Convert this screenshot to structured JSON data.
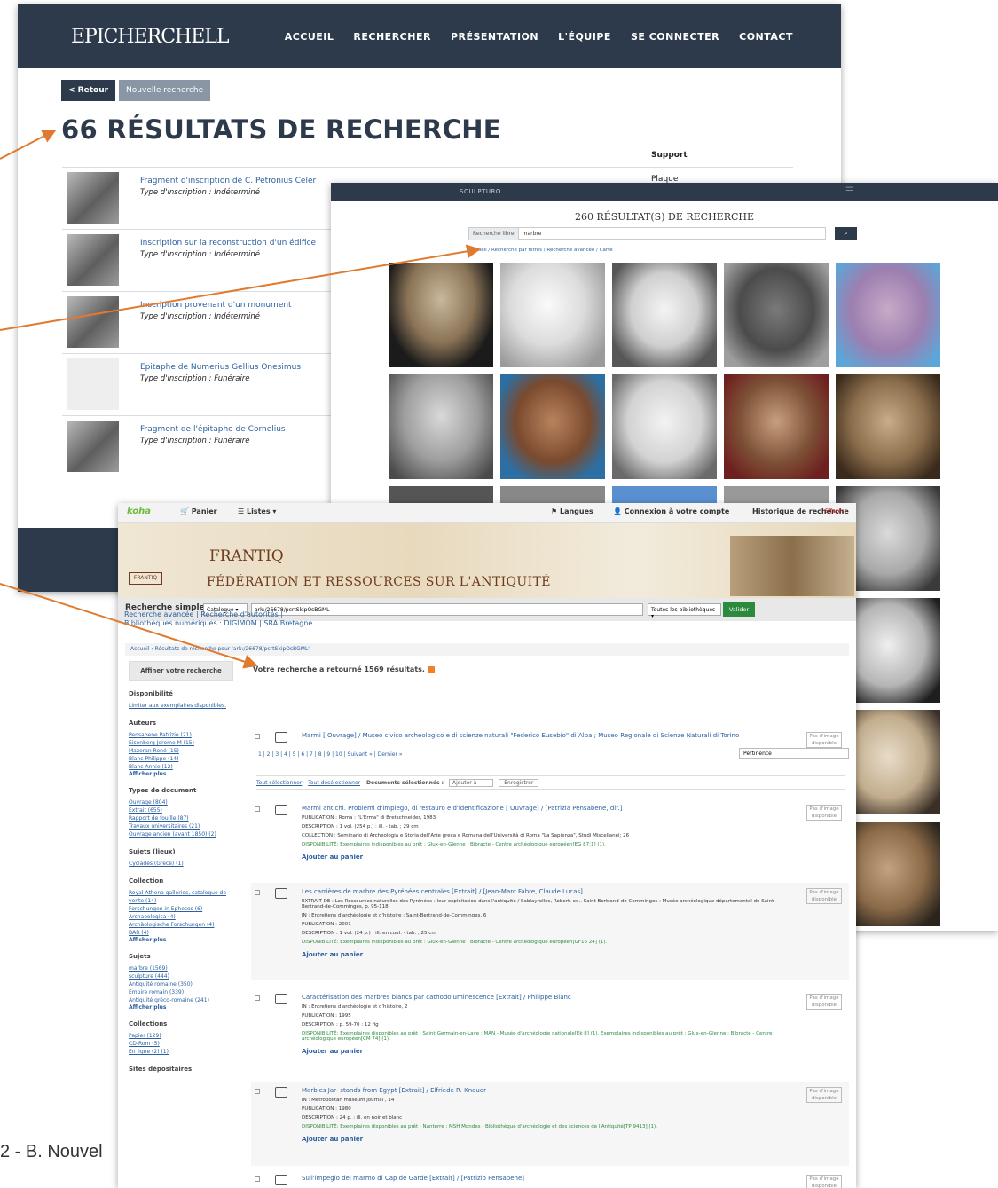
{
  "window1": {
    "logo": "EPICHERCHELL",
    "menu": [
      "ACCUEIL",
      "RECHERCHER",
      "PRÉSENTATION",
      "L'ÉQUIPE",
      "SE CONNECTER",
      "CONTACT"
    ],
    "back_label": "< Retour",
    "new_search_label": "Nouvelle recherche",
    "heading": "66 RÉSULTATS DE RECHERCHE",
    "support_header": "Support",
    "support_value": "Plaque",
    "rows": [
      {
        "title": "Fragment d'inscription de C. Petronius Celer",
        "type": "Type d'inscription : Indéterminé"
      },
      {
        "title": "Inscription sur la reconstruction d'un édifice",
        "type": "Type d'inscription : Indéterminé"
      },
      {
        "title": "Inscription provenant d'un monument",
        "type": "Type d'inscription : Indéterminé"
      },
      {
        "title": "Epitaphe de Numerius Gellius Onesimus",
        "type": "Type d'inscription : Funéraire"
      },
      {
        "title": "Fragment de l'épitaphe de Cornelius",
        "type": "Type d'inscription : Funéraire"
      }
    ]
  },
  "window2": {
    "brand": "SCULPTURO",
    "title": "260 RÉSULTAT(S) DE RECHERCHE",
    "search_label": "Recherche libre",
    "search_value": "marbre",
    "crumbs": "Accueil / Recherche par filtres / Recherche avancée / Carte"
  },
  "window3": {
    "topbar": {
      "brand": "koha",
      "cart": "Panier",
      "lists": "Listes",
      "languages": "Langues",
      "login": "Connexion à votre compte",
      "history": "Historique de recherche",
      "clear": "Effacer"
    },
    "banner_title": "FRANTIQ",
    "banner_subtitle": "FÉDÉRATION ET RESSOURCES SUR L'ANTIQUITÉ",
    "simple_search": "Recherche simple",
    "catalog_select": "Catalogue",
    "query": "ark:/26678/pcrtSkipOsBGML",
    "libraries_select": "Toutes les bibliothèques",
    "submit": "Valider",
    "links_line1": "Recherche avancée | Recherche d'autorités |",
    "links_line2": "Bibliothèques numériques : DIGIMOM | SRA Bretagne",
    "breadcrumb": "Accueil › Résultats de recherche pour 'ark:/26678/pcrtSkipOsBGML'",
    "refine": "Affiner votre recherche",
    "result_count": "Votre recherche a retourné 1569 résultats.",
    "sort": "Pertinence",
    "pages": [
      "1",
      "2",
      "3",
      "4",
      "5",
      "6",
      "7",
      "8",
      "9",
      "10",
      "Suivant »",
      "Dernier »"
    ],
    "select_all": "Tout sélectionner",
    "deselect_all": "Tout désélectionner",
    "selected_docs": "Documents sélectionnés :",
    "add_to": "Ajouter à",
    "save": "Enregistrer",
    "facets": {
      "availability_h": "Disponibilité",
      "availability_link": "Limiter aux exemplaires disponibles.",
      "authors_h": "Auteurs",
      "authors": [
        "Pensabene Patrizio (21)",
        "Eisenberg Jerome M (15)",
        "Mazeran René (15)",
        "Blanc Philippe (14)",
        "Blanc Annie (12)"
      ],
      "doctypes_h": "Types de document",
      "doctypes": [
        "Ouvrage (804)",
        "Extrait (655)",
        "Rapport de fouille (87)",
        "Travaux universitaires (21)",
        "Ouvrage ancien (avant 1850) (2)"
      ],
      "places_h": "Sujets (lieux)",
      "places": [
        "Cyclades (Grèce) (1)"
      ],
      "collection_h": "Collection",
      "collection": [
        "Royal-Athena galleries, catalogue de vente (14)",
        "Forschungen in Ephesos (6)",
        "Archaeologica (4)",
        "Archäologische Forschungen (4)",
        "BAR (4)"
      ],
      "subjects_h": "Sujets",
      "subjects": [
        "marbre (1569)",
        "sculpture (444)",
        "Antiquité romaine (350)",
        "Empire romain (339)",
        "Antiquité gréco-romaine (241)"
      ],
      "collections_h": "Collections",
      "collections": [
        "Papier (129)",
        "CD-Rom (5)",
        "En ligne (2) (1)"
      ],
      "sites_h": "Sites dépositaires",
      "show_more": "Afficher plus"
    },
    "records": [
      {
        "title": "Marmi [ Ouvrage] / Museo civico archeologico e di scienze naturali \"Federico Eusebio\" di Alba ; Museo Regionale di Scienze Naturali di Torino",
        "lines": [],
        "cart": ""
      },
      {
        "title": "Marmi antichi. Problemi d'impiego, di restauro e d'identificazione [ Ouvrage] / [Patrizia Pensabene, dir.]",
        "lines": [
          "PUBLICATION : Roma : \"L'Erma\" di Bretschneider, 1983",
          "DESCRIPTION : 1 vol. (254 p.) : ill. - tab. ; 29 cm",
          "COLLECTION : Seminario di Archeologia e Storia dell'Arte greca e Romana dell'Università di Roma \"La Sapienza\", Studi Miscellanei; 26",
          "DISPONIBILITÉ: Exemplaires indisponibles au prêt : Glux-en-Glenne : Bibracte - Centre archéologique européen[EG 87:1] (1)."
        ],
        "cart": "Ajouter au panier"
      },
      {
        "title": "Les carrières de marbre des Pyrénées centrales [Extrait] / [Jean-Marc Fabre, Claude Lucas]",
        "lines": [
          "EXTRAIT DE : Les Ressources naturelles des Pyrénées : leur exploitation dans l'antiquité / Sablayrolles, Robert, ed.. Saint-Bertrand-de-Comminges : Musée archéologique départemental de Saint-Bertrand-de-Comminges, p. 95-118",
          "IN : Entretiens d'archéologie et d'histoire : Saint-Bertrand-de-Comminges, 6",
          "PUBLICATION : 2001",
          "DESCRIPTION : 1 vol. (24 p.) : ill. en coul. - tab. ; 25 cm",
          "DISPONIBILITÉ: Exemplaires indisponibles au prêt : Glux-en-Glenne : Bibracte - Centre archéologique européen[GF16 24] (1)."
        ],
        "cart": "Ajouter au panier"
      },
      {
        "title": "Caractérisation des marbres blancs par cathodoluminescence [Extrait] / Philippe Blanc",
        "lines": [
          "IN : Entretiens d'archéologie et d'histoire, 2",
          "PUBLICATION : 1995",
          "DESCRIPTION : p. 59-70 : 12 fig",
          "DISPONIBILITÉ: Exemplaires disponibles au prêt : Saint-Germain-en-Laye : MAN - Musée d'archéologie nationale[Ek 8] (1). Exemplaires indisponibles au prêt : Glux-en-Glenne : Bibracte - Centre archéologique européen[CM 74] (1)."
        ],
        "cart": "Ajouter au panier"
      },
      {
        "title": "Marbles Jar- stands from Egypt [Extrait] / Elfriede R. Knauer",
        "lines": [
          "IN : Metropolitan museum journal , 14",
          "PUBLICATION : 1980",
          "DESCRIPTION : 24 p. : ill. en noir et blanc",
          "DISPONIBILITÉ: Exemplaires disponibles au prêt : Nanterre : MSH Mondes - Bibliothèque d'archéologie et des sciences de l'Antiquité[TP 9413] (1)."
        ],
        "cart": "Ajouter au panier"
      },
      {
        "title": "Sull'impegio del marmo di Cap de Garde [Extrait] / [Patrizio Pensabene]",
        "lines": [],
        "cart": ""
      }
    ],
    "no_image": "Pas d'image disponible"
  },
  "footer": "2 - B. Nouvel",
  "colors": {
    "navy": "#2d3a4b",
    "arrow": "#e07a2e",
    "link": "#2a5fa0",
    "green": "#2b8a3e"
  }
}
